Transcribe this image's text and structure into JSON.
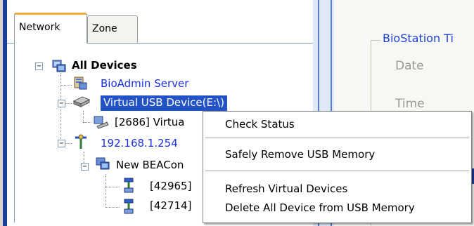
{
  "tabs": [
    {
      "label": "Network",
      "active": true
    },
    {
      "label": "Zone",
      "active": false
    }
  ],
  "tree": {
    "root": {
      "label": "All Devices",
      "expander": "−"
    },
    "server": {
      "label": "BioAdmin Server"
    },
    "usb": {
      "label": "Virtual USB Device(E:\\)",
      "expander": "−",
      "selected": true
    },
    "usb_child": {
      "label": "[2686] Virtua"
    },
    "ip": {
      "label": "192.168.1.254",
      "expander": "−"
    },
    "bea": {
      "label": "New BEACon",
      "expander": "−"
    },
    "dev1": {
      "label": "[42965]"
    },
    "dev2": {
      "label": "[42714]"
    }
  },
  "right_panel": {
    "group_title": "BioStation Ti",
    "date_label": "Date",
    "time_label": "Time"
  },
  "context_menu": {
    "items": [
      "Check Status",
      "Safely Remove USB Memory",
      "Refresh Virtual Devices",
      "Delete All Device from USB Memory"
    ]
  },
  "colors": {
    "accent_blue": "#1c3f9e",
    "link_blue": "#1a2fe0",
    "selection": "#2352c7",
    "tab_highlight": "#f2a93b"
  }
}
